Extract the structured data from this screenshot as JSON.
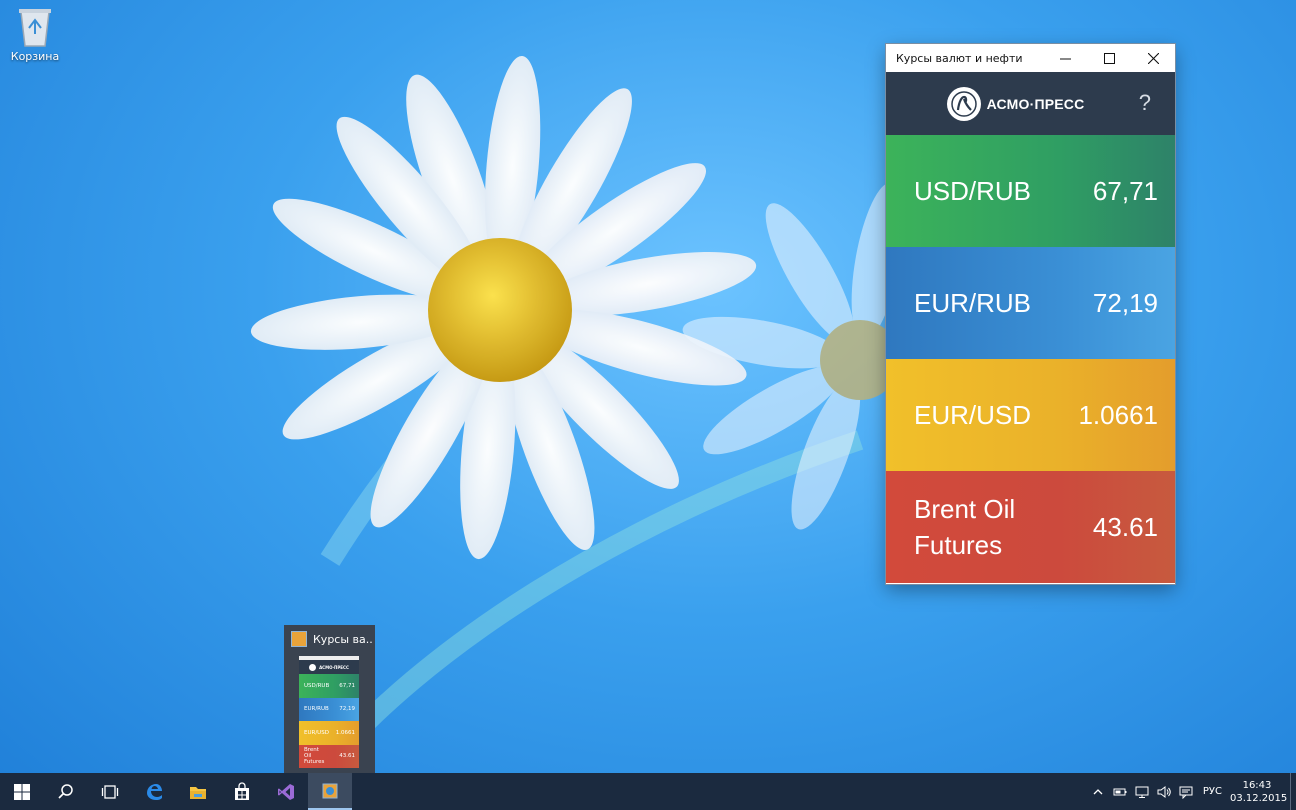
{
  "desktop": {
    "recycle_bin_label": "Корзина"
  },
  "window": {
    "title": "Курсы валют и нефти",
    "logo_text": "АСМО·ПРЕСС",
    "help_label": "?",
    "rates": [
      {
        "pair": "USD/RUB",
        "value": "67,71"
      },
      {
        "pair": "EUR/RUB",
        "value": "72,19"
      },
      {
        "pair": "EUR/USD",
        "value": "1.0661"
      },
      {
        "pair": "Brent Oil Futures",
        "value": "43.61"
      }
    ]
  },
  "thumbnail": {
    "title": "Курсы ва..."
  },
  "taskbar": {
    "language": "РУС",
    "time": "16:43",
    "date": "03.12.2015"
  },
  "colors": {
    "header_bg": "#2d3b4d",
    "usd_rub": "#3cb35a",
    "eur_rub": "#3a8fd5",
    "eur_usd": "#f1c02a",
    "brent": "#d24a3b",
    "taskbar_bg": "#1b2a3f"
  }
}
